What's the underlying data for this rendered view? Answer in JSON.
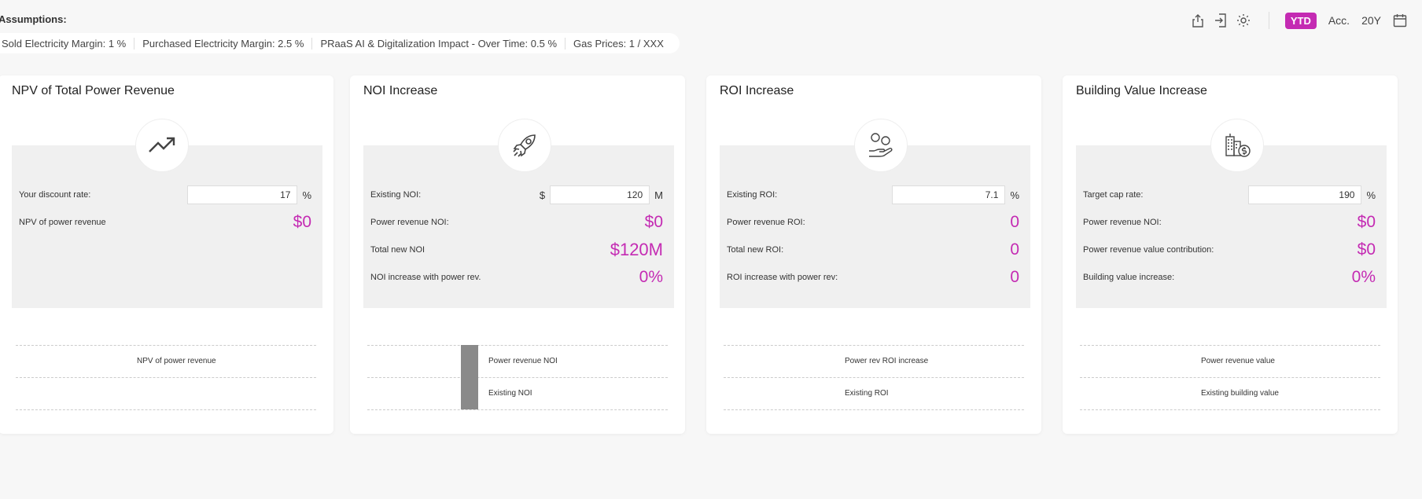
{
  "assumptions": {
    "title": "Assumptions:",
    "items": [
      "Sold Electricity Margin: 1 %",
      "Purchased Electricity Margin: 2.5 %",
      "PRaaS AI & Digitalization Impact - Over Time: 0.5 %",
      "Gas Prices: 1 / XXX"
    ]
  },
  "toolbar": {
    "icons": [
      "share-icon",
      "login-icon",
      "settings-icon"
    ],
    "period_active": "YTD",
    "period_acc": "Acc.",
    "period_20y": "20Y",
    "calendar_icon": "calendar-icon"
  },
  "accent_color": "#c42bb3",
  "cards": {
    "npv": {
      "title": "NPV of Total Power Revenue",
      "icon": "trending-up-icon",
      "discount_label": "Your discount rate:",
      "discount_value": "17",
      "discount_unit": "%",
      "npv_label": "NPV of power revenue",
      "npv_value": "$0",
      "chart_label": "NPV of power revenue"
    },
    "noi": {
      "title": "NOI Increase",
      "icon": "rocket-icon",
      "existing_label": "Existing NOI:",
      "existing_currency": "$",
      "existing_value": "120",
      "existing_unit": "M",
      "power_label": "Power revenue NOI:",
      "power_value": "$0",
      "total_label": "Total new NOI",
      "total_value": "$120M",
      "increase_label": "NOI increase with power rev.",
      "increase_value": "0%",
      "chart_label_top": "Power revenue NOI",
      "chart_label_bottom": "Existing NOI"
    },
    "roi": {
      "title": "ROI Increase",
      "icon": "hand-coins-icon",
      "existing_label": "Existing ROI:",
      "existing_value": "7.1",
      "existing_unit": "%",
      "power_label": "Power revenue ROI:",
      "power_value": "0",
      "total_label": "Total new ROI:",
      "total_value": "0",
      "increase_label": "ROI increase with power rev:",
      "increase_value": "0",
      "chart_label_top": "Power rev ROI increase",
      "chart_label_bottom": "Existing ROI"
    },
    "building": {
      "title": "Building Value Increase",
      "icon": "building-dollar-icon",
      "cap_label": "Target cap rate:",
      "cap_value": "190",
      "cap_unit": "%",
      "power_label": "Power revenue NOI:",
      "power_value": "$0",
      "contrib_label": "Power revenue value contribution:",
      "contrib_value": "$0",
      "increase_label": "Building value increase:",
      "increase_value": "0%",
      "chart_label_top": "Power revenue value",
      "chart_label_bottom": "Existing building value"
    }
  }
}
